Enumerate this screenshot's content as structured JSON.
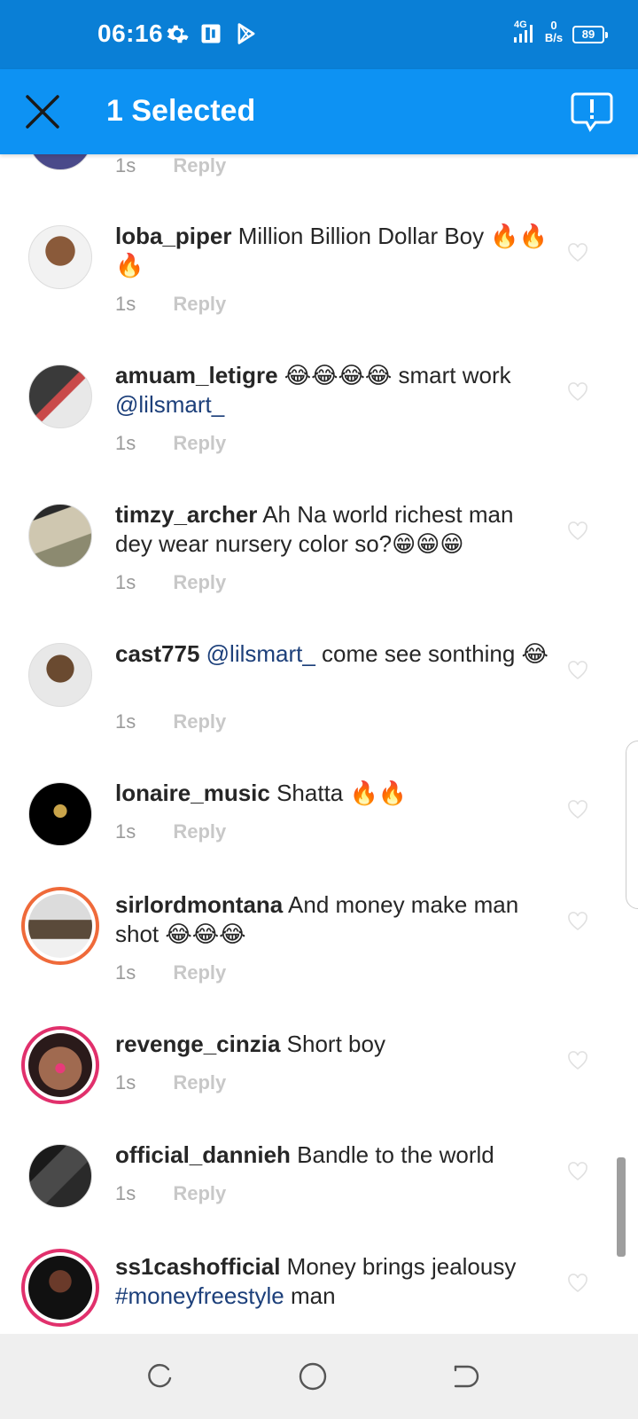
{
  "status_bar": {
    "time": "06:16",
    "network": "4G",
    "speed_value": "0",
    "speed_unit": "B/s",
    "battery": "89",
    "icons": [
      "gear-icon",
      "app-icon",
      "play-store-icon",
      "signal-icon"
    ]
  },
  "action_bar": {
    "title": "1 Selected",
    "close_icon": "close-icon",
    "report_icon": "report-icon"
  },
  "comments": [
    {
      "user": "",
      "text": "",
      "time": "1s",
      "reply": "Reply"
    },
    {
      "user": "loba_piper",
      "text": " Million Billion Dollar Boy 🔥🔥🔥",
      "time": "1s",
      "reply": "Reply"
    },
    {
      "user": "amuam_letigre",
      "text": " 😂😂😂😂 smart work ",
      "mention": "@lilsmart_",
      "time": "1s",
      "reply": "Reply"
    },
    {
      "user": "timzy_archer",
      "text": " Ah Na world richest man dey wear nursery color so?😁😁😁",
      "time": "1s",
      "reply": "Reply"
    },
    {
      "user": "cast775",
      "mention": " @lilsmart_",
      "text_after": " come see sonthing 😂",
      "time": "1s",
      "reply": "Reply"
    },
    {
      "user": "lonaire_music",
      "text": " Shatta 🔥🔥",
      "time": "1s",
      "reply": "Reply"
    },
    {
      "user": "sirlordmontana",
      "text": " And money make man shot 😂😂😂",
      "time": "1s",
      "reply": "Reply"
    },
    {
      "user": "revenge_cinzia",
      "text": " Short boy",
      "time": "1s",
      "reply": "Reply"
    },
    {
      "user": "official_dannieh",
      "text": " Bandle to the world",
      "time": "1s",
      "reply": "Reply"
    },
    {
      "user": "ss1cashofficial",
      "text": " Money brings jealousy ",
      "hashtag": "#moneyfreestyle",
      "text_after": " man"
    }
  ],
  "colors": {
    "status_bar": "#0a7fd6",
    "action_bar": "#0d92f3",
    "mention": "#1c3f7a",
    "story_ring": "#e1306c"
  },
  "nav_bar": {
    "icons": [
      "recents-icon",
      "home-icon",
      "back-icon"
    ]
  }
}
